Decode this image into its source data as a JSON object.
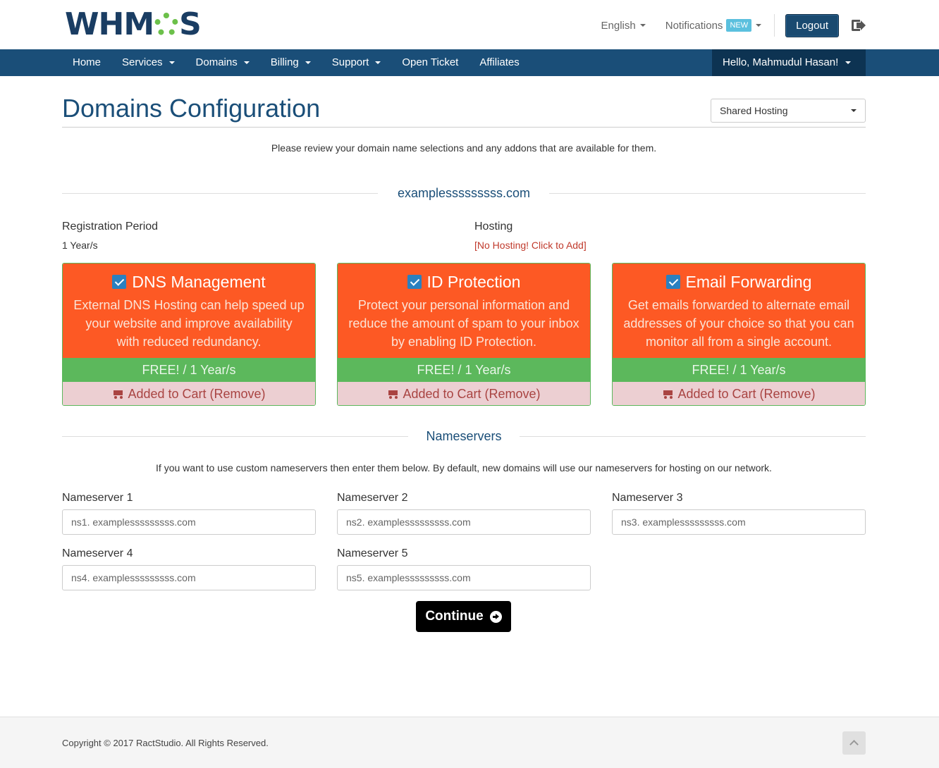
{
  "header": {
    "logo_text_left": "WHM",
    "logo_text_right": "S",
    "logo_full": "WHMCS",
    "language": "English",
    "notifications": "Notifications",
    "notifications_badge": "NEW",
    "logout": "Logout"
  },
  "nav": {
    "items": [
      {
        "label": "Home",
        "dropdown": false
      },
      {
        "label": "Services",
        "dropdown": true
      },
      {
        "label": "Domains",
        "dropdown": true
      },
      {
        "label": "Billing",
        "dropdown": true
      },
      {
        "label": "Support",
        "dropdown": true
      },
      {
        "label": "Open Ticket",
        "dropdown": false
      },
      {
        "label": "Affiliates",
        "dropdown": false
      }
    ],
    "user": "Hello, Mahmudul Hasan!"
  },
  "page": {
    "title": "Domains Configuration",
    "category_select": "Shared Hosting",
    "intro": "Please review your domain name selections and any addons that are available for them."
  },
  "domain": {
    "name": "examplesssssssss.com",
    "registration_label": "Registration Period",
    "registration_value": "1 Year/s",
    "hosting_label": "Hosting",
    "hosting_value": "[No Hosting! Click to Add]"
  },
  "addons": [
    {
      "title": "DNS Management",
      "desc": "External DNS Hosting can help speed up your website and improve availability with reduced redundancy.",
      "price": "FREE! / 1 Year/s",
      "cart": "Added to Cart (Remove)",
      "checked": true
    },
    {
      "title": "ID Protection",
      "desc": "Protect your personal information and reduce the amount of spam to your inbox by enabling ID Protection.",
      "price": "FREE! / 1 Year/s",
      "cart": "Added to Cart (Remove)",
      "checked": true
    },
    {
      "title": "Email Forwarding",
      "desc": "Get emails forwarded to alternate email addresses of your choice so that you can monitor all from a single account.",
      "price": "FREE! / 1 Year/s",
      "cart": "Added to Cart (Remove)",
      "checked": true
    }
  ],
  "nameservers": {
    "heading": "Nameservers",
    "intro": "If you want to use custom nameservers then enter them below. By default, new domains will use our nameservers for hosting on our network.",
    "fields": [
      {
        "label": "Nameserver 1",
        "placeholder": "ns1. examplesssssssss.com"
      },
      {
        "label": "Nameserver 2",
        "placeholder": "ns2. examplesssssssss.com"
      },
      {
        "label": "Nameserver 3",
        "placeholder": "ns3. examplesssssssss.com"
      },
      {
        "label": "Nameserver 4",
        "placeholder": "ns4. examplesssssssss.com"
      },
      {
        "label": "Nameserver 5",
        "placeholder": "ns5. examplesssssssss.com"
      }
    ]
  },
  "continue_label": "Continue",
  "footer": {
    "copyright": "Copyright © 2017 RactStudio. All Rights Reserved."
  },
  "colors": {
    "brand_blue": "#1a4e78",
    "addon_orange": "#fd5924",
    "addon_green": "#5cb85c",
    "cart_pink": "#eccfd2",
    "link_red": "#c0392b"
  }
}
